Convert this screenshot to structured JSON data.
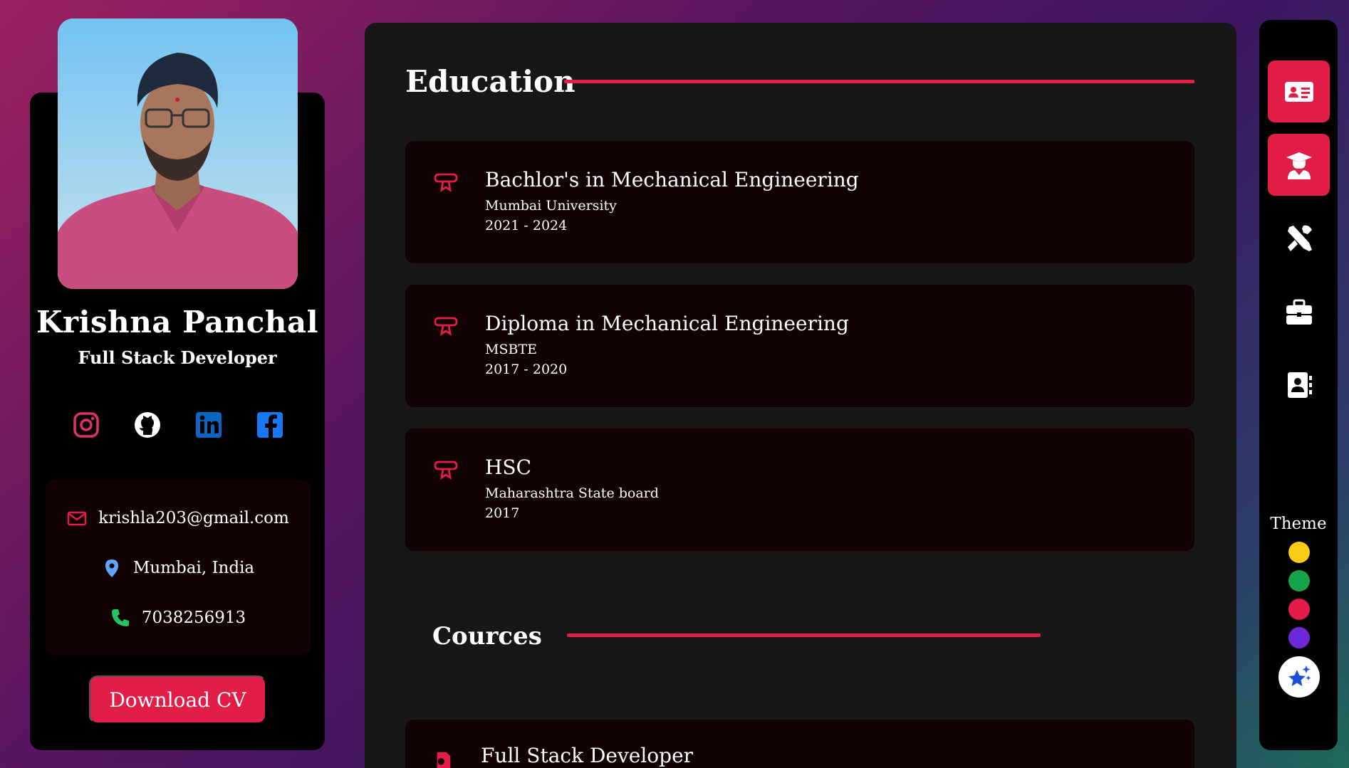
{
  "profile": {
    "name": "Krishna Panchal",
    "role": "Full Stack Developer",
    "socials": [
      {
        "name": "instagram-icon",
        "color": "#e1306c"
      },
      {
        "name": "github-icon",
        "color": "#ffffff"
      },
      {
        "name": "linkedin-icon",
        "color": "#0a66c2"
      },
      {
        "name": "facebook-icon",
        "color": "#1877f2"
      }
    ],
    "contact": {
      "email": "krishla203@gmail.com",
      "location": "Mumbai, India",
      "phone": "7038256913"
    },
    "download_label": "Download CV"
  },
  "education": {
    "title": "Education",
    "items": [
      {
        "degree": "Bachlor's in Mechanical Engineering",
        "institution": "Mumbai University",
        "years": "2021 - 2024"
      },
      {
        "degree": "Diploma in Mechanical Engineering",
        "institution": "MSBTE",
        "years": "2017 - 2020"
      },
      {
        "degree": "HSC",
        "institution": "Maharashtra State board",
        "years": "2017"
      }
    ]
  },
  "courses": {
    "title": "Cources",
    "items": [
      {
        "title": "Full Stack Developer"
      }
    ]
  },
  "nav": {
    "items": [
      {
        "name": "about-icon",
        "active": true
      },
      {
        "name": "education-icon",
        "active": true
      },
      {
        "name": "skills-icon",
        "active": false
      },
      {
        "name": "experience-icon",
        "active": false
      },
      {
        "name": "contact-icon",
        "active": false
      }
    ],
    "theme_label": "Theme",
    "theme_colors": [
      "#facc15",
      "#16a34a",
      "#e11d48",
      "#6d28d9"
    ]
  },
  "colors": {
    "accent": "#e11d48",
    "panel": "#171717",
    "card": "#120203"
  }
}
